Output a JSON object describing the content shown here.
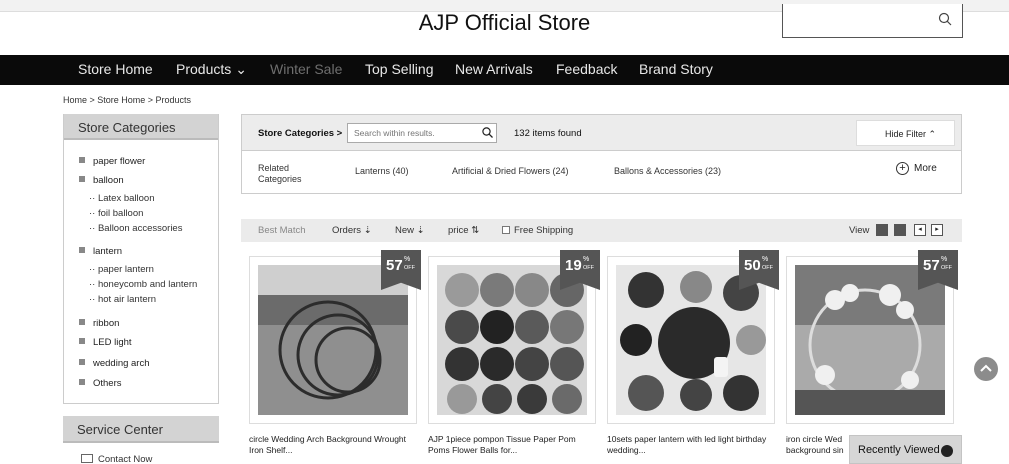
{
  "header": {
    "store_title": "AJP Official Store",
    "search_placeholder": ""
  },
  "nav": {
    "items": [
      {
        "label": "Store Home"
      },
      {
        "label": "Products"
      },
      {
        "label": "Winter Sale"
      },
      {
        "label": "Top Selling"
      },
      {
        "label": "New Arrivals"
      },
      {
        "label": "Feedback"
      },
      {
        "label": "Brand Story"
      }
    ]
  },
  "breadcrumb": "Home > Store Home > Products",
  "sidebar": {
    "title": "Store Categories",
    "categories": [
      {
        "label": "paper flower"
      },
      {
        "label": "balloon",
        "subs": [
          "Latex balloon",
          "foil balloon",
          "Balloon accessories"
        ]
      },
      {
        "label": "lantern",
        "subs": [
          "paper lantern",
          "honeycomb and lantern",
          "hot air lantern"
        ]
      },
      {
        "label": "ribbon"
      },
      {
        "label": "LED light"
      },
      {
        "label": "wedding arch"
      },
      {
        "label": "Others"
      }
    ],
    "service_title": "Service Center",
    "contact_label": "Contact Now"
  },
  "filter": {
    "label": "Store Categories >",
    "search_placeholder": "Search within results.",
    "count": "132 items found",
    "hide_filter": "Hide Filter",
    "related_label": "Related Categories",
    "related": [
      "Lanterns (40)",
      "Artificial & Dried Flowers (24)",
      "Ballons & Accessories (23)"
    ],
    "more": "More"
  },
  "sort": {
    "best_match": "Best Match",
    "orders": "Orders",
    "new": "New",
    "price": "price",
    "free_shipping": "Free Shipping",
    "view": "View"
  },
  "products": [
    {
      "discount": "57",
      "title": "circle Wedding Arch Background Wrought Iron Shelf..."
    },
    {
      "discount": "19",
      "title": "AJP 1piece pompon Tissue Paper Pom Poms Flower Balls for..."
    },
    {
      "discount": "50",
      "title": "10sets paper lantern with led light birthday wedding..."
    },
    {
      "discount": "57",
      "title": "iron circle Wed background sin"
    }
  ],
  "badge": {
    "percent_symbol": "%",
    "off": "OFF"
  },
  "recently_viewed": "Recently Viewed"
}
